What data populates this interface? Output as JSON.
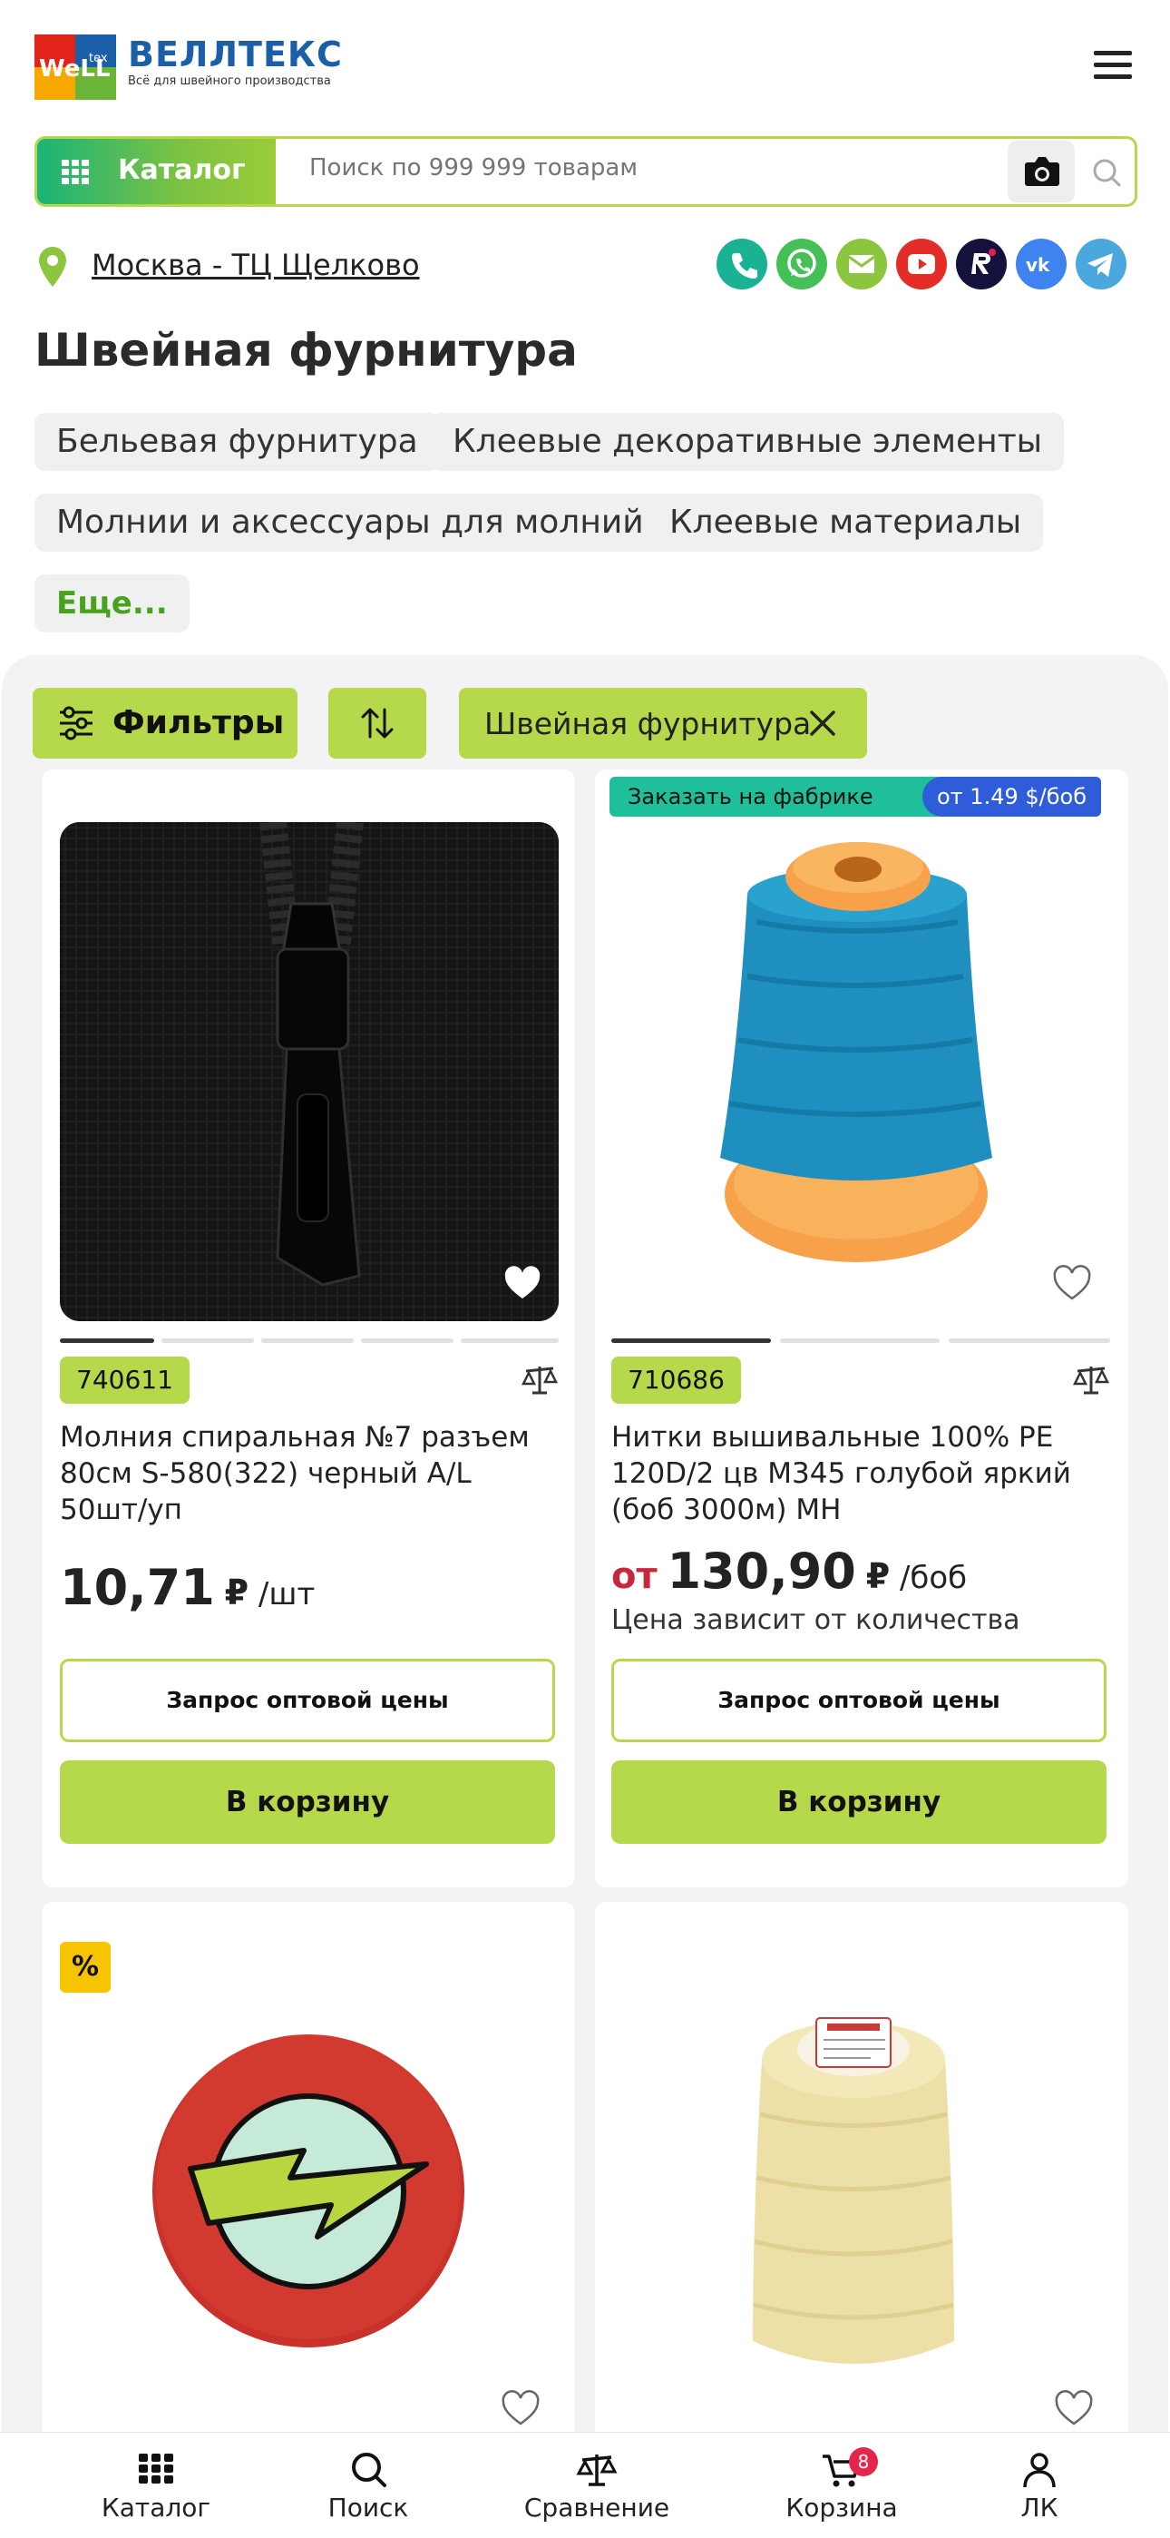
{
  "header": {
    "logo_mark": "WeLLtex",
    "logo_name": "ВЕЛЛТЕКС",
    "logo_tagline": "Всё для швейного производства",
    "menu_icon": "burger-menu-icon"
  },
  "search": {
    "catalog_label": "Каталог",
    "placeholder": "Поиск по 999 999 товарам"
  },
  "location": {
    "label": "Москва - ТЦ Щелково"
  },
  "socials": [
    "phone-icon",
    "whatsapp-icon",
    "email-icon",
    "youtube-icon",
    "rutube-icon",
    "vk-icon",
    "telegram-icon"
  ],
  "category": {
    "title": "Швейная фурнитура",
    "subcategories": [
      "Бельевая фурнитура",
      "Клеевые декоративные элементы",
      "Молнии и аксессуары для молний",
      "Клеевые материалы"
    ],
    "more_label": "Еще..."
  },
  "filters": {
    "filters_label": "Фильтры",
    "active_tag": "Швейная фурнитура"
  },
  "products": [
    {
      "sku": "740611",
      "title": "Молния спиральная №7 разъем 80см S-580(322) черный A/L 50шт/уп",
      "price_prefix": "",
      "price": "10,71",
      "currency": "₽",
      "unit": "/шт",
      "note": "",
      "wholesale_label": "Запрос оптовой цены",
      "cart_label": "В корзину",
      "image_slides": 5,
      "active_slide": 1
    },
    {
      "sku": "710686",
      "badge_factory": "Заказать на фабрике",
      "badge_factory_price": "от 1.49 $/боб",
      "title": "Нитки вышивальные 100% PE 120D/2 цв M345 голубой яркий (боб 3000м) MH",
      "price_prefix": "от",
      "price": "130,90",
      "currency": "₽",
      "unit": "/боб",
      "note": "Цена зависит от количества",
      "wholesale_label": "Запрос оптовой цены",
      "cart_label": "В корзину",
      "image_slides": 3,
      "active_slide": 1
    },
    {
      "discount_badge": "%"
    },
    {}
  ],
  "bottom_nav": [
    {
      "label": "Каталог",
      "icon": "grid-icon"
    },
    {
      "label": "Поиск",
      "icon": "search-icon"
    },
    {
      "label": "Сравнение",
      "icon": "scales-icon"
    },
    {
      "label": "Корзина",
      "icon": "cart-icon",
      "badge": "8"
    },
    {
      "label": "ЛК",
      "icon": "user-icon"
    }
  ],
  "colors": {
    "accent": "#b5d94a",
    "brand_blue": "#1b5fa8",
    "price_red": "#c7283c",
    "factory_green": "#1fbf9b",
    "factory_blue": "#2f5cd8"
  }
}
